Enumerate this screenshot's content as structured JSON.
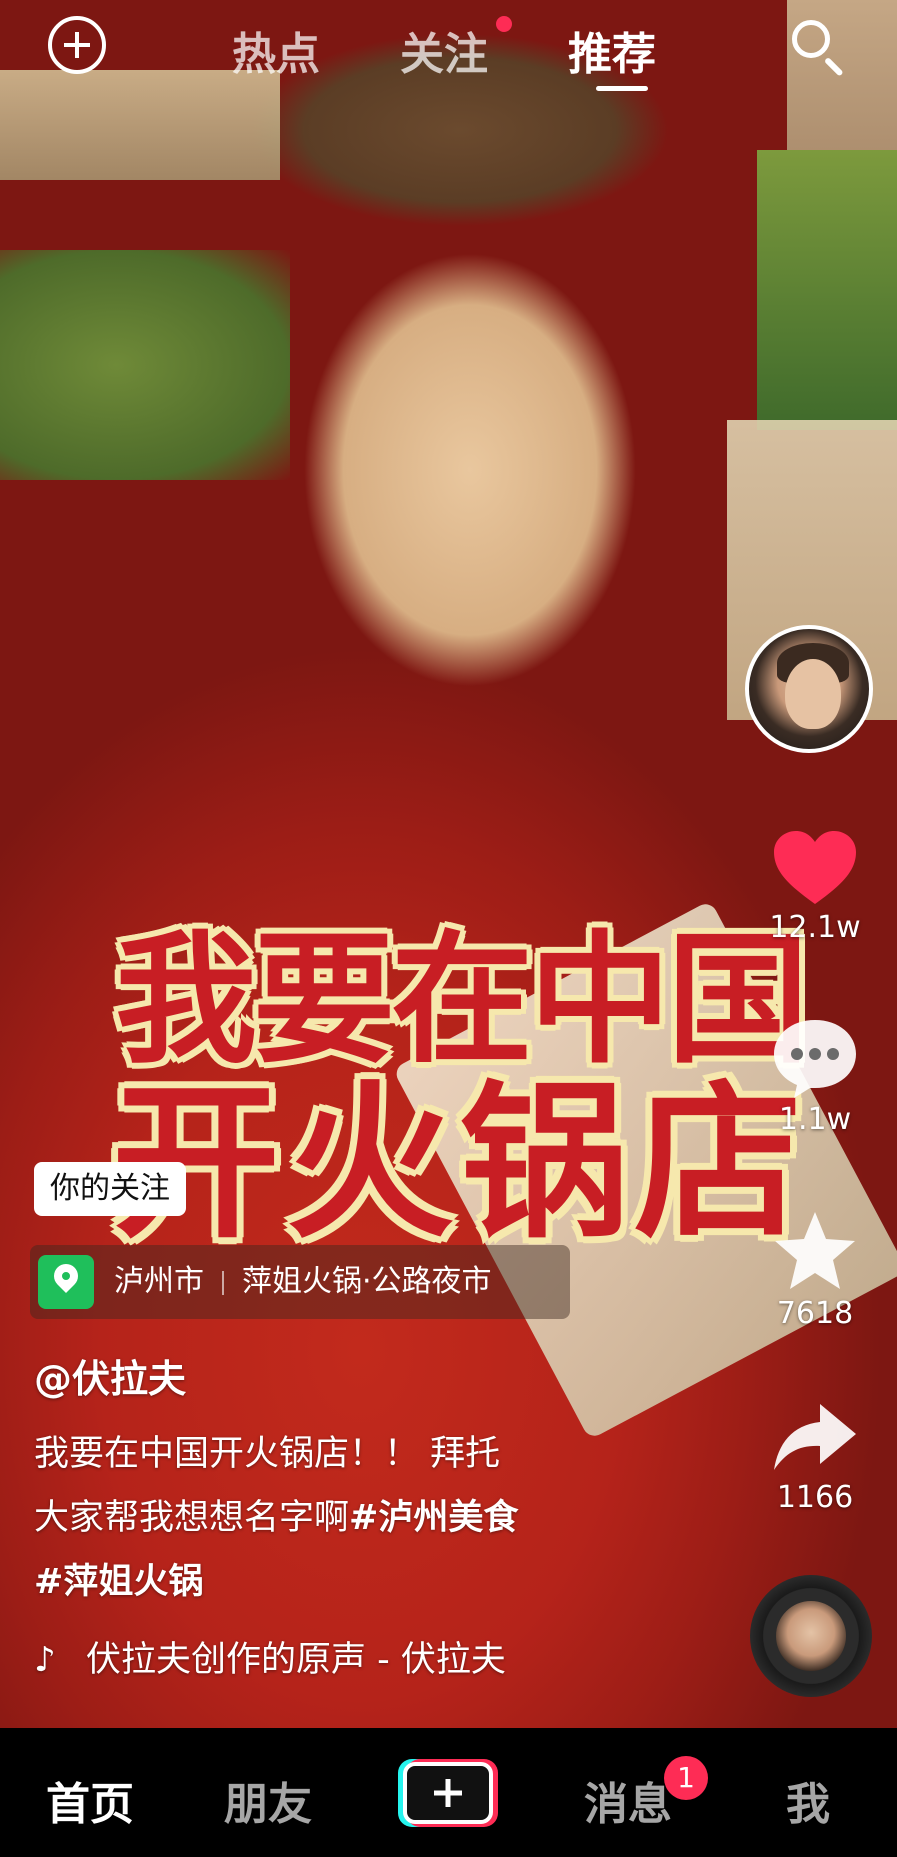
{
  "top_tabs": {
    "hot": "热点",
    "follow": "关注",
    "recommend": "推荐"
  },
  "video": {
    "overlay_title_line1": "我要在中国",
    "overlay_title_line2": "开火锅店",
    "follow_tag": "你的关注",
    "location": {
      "city": "泸州市",
      "place": "萍姐火锅·公路夜市"
    },
    "author": "@伏拉夫",
    "description_line1": "我要在中国开火锅店！！ 拜托",
    "description_line2_text": "大家帮我想想名字啊",
    "hashtag1": "#泸州美食",
    "hashtag2": "#萍姐火锅",
    "music": "伏拉夫创作的原声 - 伏拉夫"
  },
  "actions": {
    "likes": "12.1w",
    "comments": "1.1w",
    "favorites": "7618",
    "shares": "1166"
  },
  "bottom_nav": {
    "home": "首页",
    "friends": "朋友",
    "messages": "消息",
    "messages_badge": "1",
    "me": "我"
  },
  "colors": {
    "accent": "#fe2c55",
    "cyan": "#25f4ee",
    "location_green": "#1fbf5b",
    "overlay_red": "#c81e24",
    "overlay_outline": "#f6e8ad"
  }
}
